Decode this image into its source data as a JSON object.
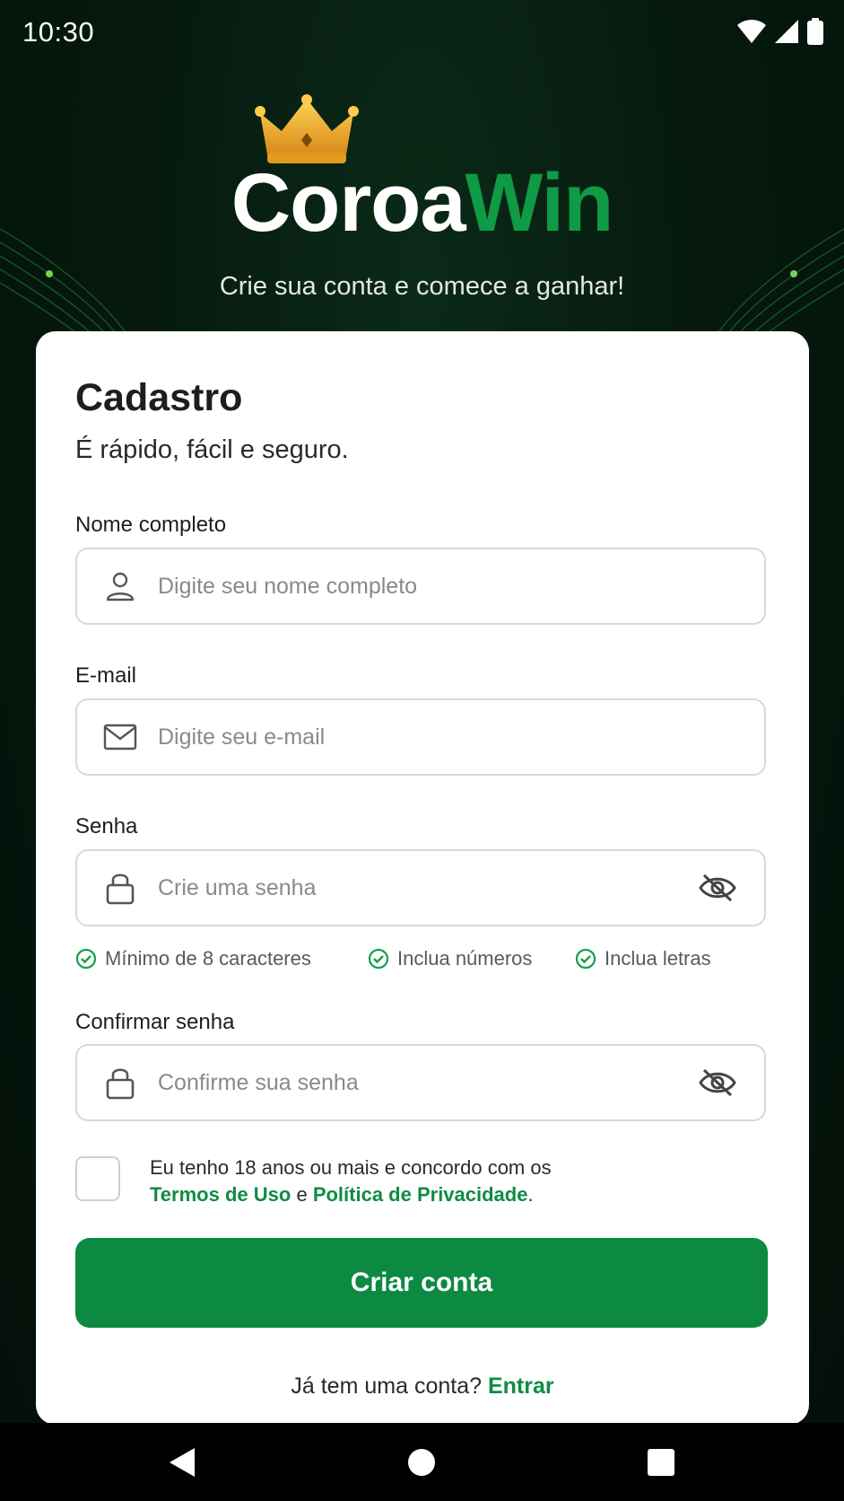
{
  "status_bar": {
    "time": "10:30"
  },
  "brand": {
    "part1": "Coroa",
    "part2": "Win",
    "tagline": "Crie sua conta e comece a ganhar!"
  },
  "form": {
    "title": "Cadastro",
    "subtitle": "É rápido, fácil e seguro.",
    "name": {
      "label": "Nome completo",
      "placeholder": "Digite seu nome completo",
      "value": ""
    },
    "email": {
      "label": "E-mail",
      "placeholder": "Digite seu e-mail",
      "value": ""
    },
    "password": {
      "label": "Senha",
      "placeholder": "Crie uma senha",
      "value": ""
    },
    "password_rules": [
      "Mínimo de 8 caracteres",
      "Inclua números",
      "Inclua letras"
    ],
    "confirm": {
      "label": "Confirmar senha",
      "placeholder": "Confirme sua senha",
      "value": ""
    },
    "terms": {
      "prefix": "Eu tenho 18 anos ou mais e concordo com os",
      "terms_link": "Termos de Uso",
      "and": "e",
      "privacy_link": "Política de Privacidade",
      "suffix": "."
    },
    "submit_label": "Criar conta",
    "login_prompt": "Já tem uma conta?",
    "login_link": "Entrar"
  },
  "colors": {
    "accent": "#0c8a42",
    "background": "#061a0f",
    "crown": "#f2b631"
  },
  "icons": [
    "wifi-icon",
    "signal-icon",
    "battery-icon",
    "crown-icon",
    "user-icon",
    "mail-icon",
    "lock-icon",
    "eye-off-icon",
    "check-circle-icon",
    "back-icon",
    "home-icon",
    "recents-icon"
  ]
}
